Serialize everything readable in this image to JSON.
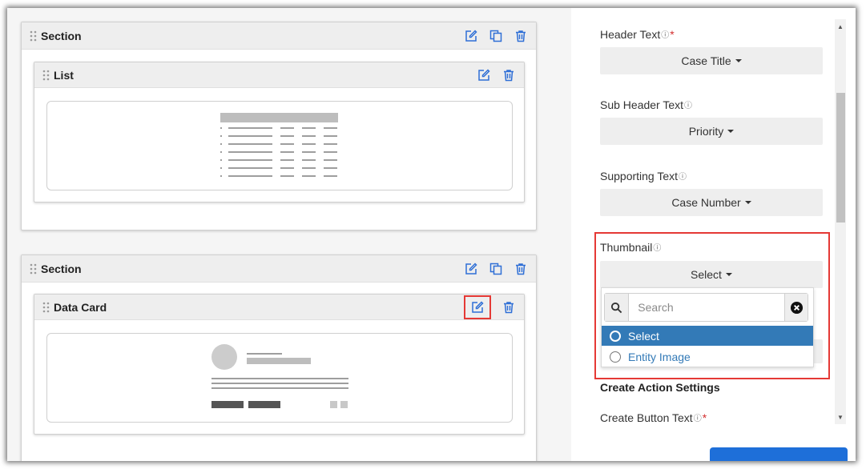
{
  "canvas": {
    "sections": [
      {
        "title": "Section",
        "widget": {
          "title": "List",
          "type": "list"
        }
      },
      {
        "title": "Section",
        "widget": {
          "title": "Data Card",
          "type": "data-card"
        }
      }
    ]
  },
  "panel": {
    "fields": [
      {
        "label": "Header Text",
        "required": true,
        "value": "Case Title"
      },
      {
        "label": "Sub Header Text",
        "required": false,
        "value": "Priority"
      },
      {
        "label": "Supporting Text",
        "required": false,
        "value": "Case Number"
      },
      {
        "label": "Thumbnail",
        "required": false,
        "value": "Select"
      }
    ],
    "thumbnail_menu": {
      "search_placeholder": "Search",
      "options": [
        {
          "label": "Select",
          "selected": true
        },
        {
          "label": "Entity Image",
          "selected": false
        }
      ]
    },
    "create_action_heading": "Create Action Settings",
    "create_button_label": "Create Button Text"
  },
  "icons": {
    "edit": "edit-icon",
    "copy": "copy-icon",
    "delete": "trash-icon",
    "drag": "drag-handle-icon",
    "help": "help-circle-icon",
    "search": "search-icon",
    "clear": "clear-circle-icon"
  },
  "colors": {
    "accent": "#337ab7",
    "icon_blue": "#2f6fd6",
    "highlight": "#e53935",
    "required": "#d32f2f"
  }
}
